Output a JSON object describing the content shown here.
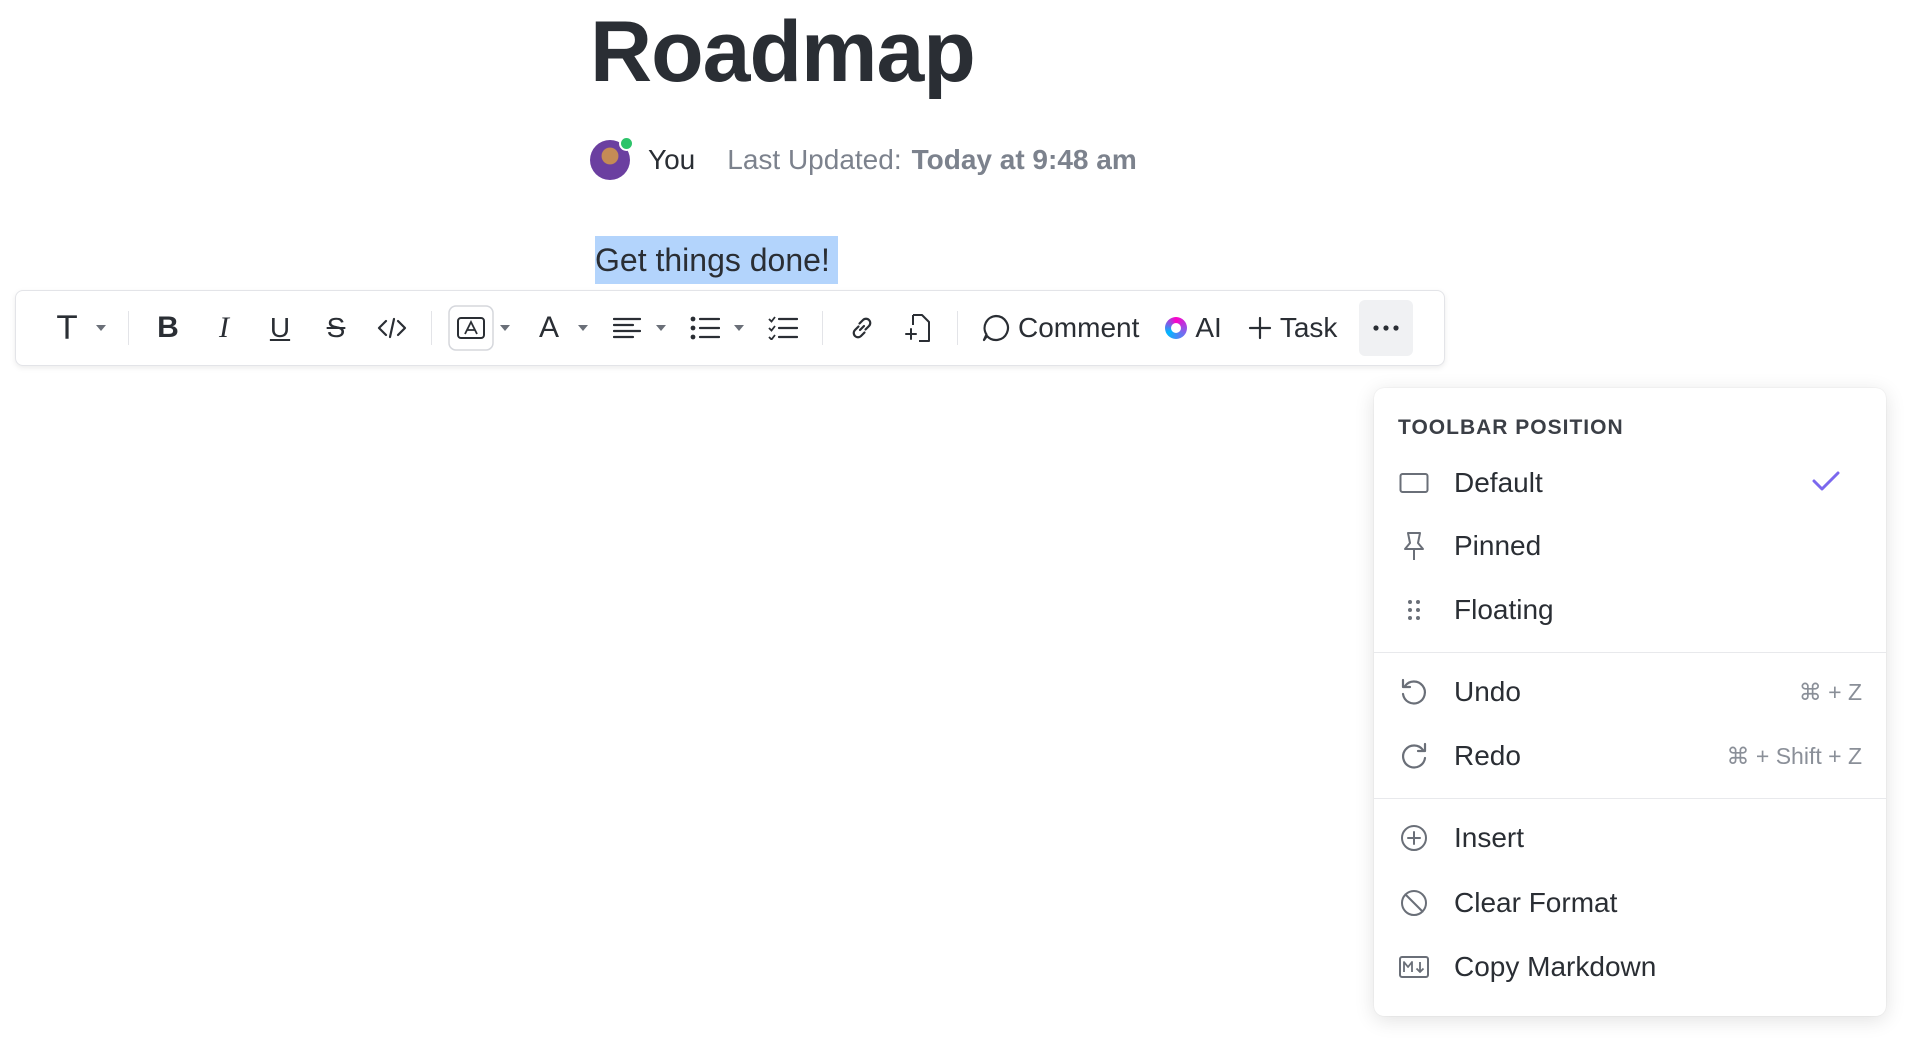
{
  "document": {
    "title": "Roadmap",
    "author": "You",
    "updated_label": "Last Updated:",
    "updated_value": "Today at 9:48 am",
    "selected_text": "Get things done!"
  },
  "toolbar": {
    "comment_label": "Comment",
    "ai_label": "AI",
    "task_label": "Task",
    "text_style_icon": "T",
    "font_icon": "A"
  },
  "menu": {
    "heading": "TOOLBAR POSITION",
    "items": [
      {
        "label": "Default",
        "icon": "rectangle-icon",
        "selected": true
      },
      {
        "label": "Pinned",
        "icon": "pin-icon"
      },
      {
        "label": "Floating",
        "icon": "drag-handle-icon"
      },
      {
        "label": "Undo",
        "icon": "undo-icon",
        "shortcut": "⌘ + Z"
      },
      {
        "label": "Redo",
        "icon": "redo-icon",
        "shortcut": "⌘ + Shift + Z"
      },
      {
        "label": "Insert",
        "icon": "plus-circle-icon"
      },
      {
        "label": "Clear Format",
        "icon": "prohibit-icon"
      },
      {
        "label": "Copy Markdown",
        "icon": "markdown-icon"
      }
    ]
  },
  "colors": {
    "accent": "#7b68ee",
    "selection": "#b3d4fc",
    "presence": "#2dc36a",
    "muted_text": "#7c828d"
  }
}
